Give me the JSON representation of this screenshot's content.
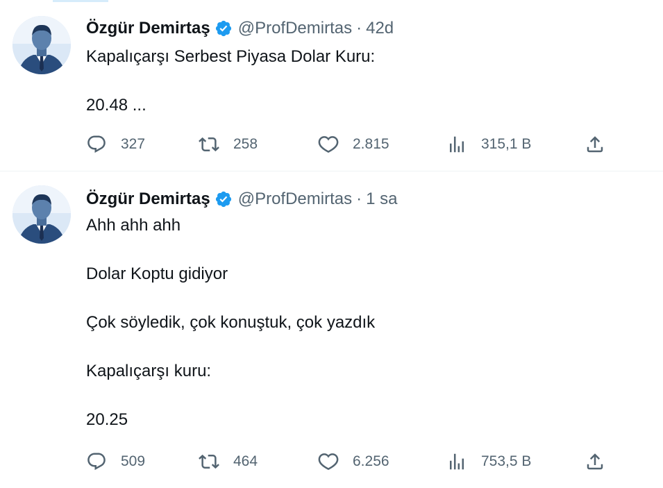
{
  "tweets": [
    {
      "author": "Özgür Demirtaş",
      "handle": "@ProfDemirtas",
      "separator": "·",
      "time": "42d",
      "paragraphs": [
        "Kapalıçarşı Serbest Piyasa Dolar Kuru:",
        "20.48 ..."
      ],
      "stats": {
        "replies": "327",
        "retweets": "258",
        "likes": "2.815",
        "views": "315,1 B"
      }
    },
    {
      "author": "Özgür Demirtaş",
      "handle": "@ProfDemirtas",
      "separator": "·",
      "time": "1 sa",
      "paragraphs": [
        "Ahh ahh ahh",
        "Dolar Koptu gidiyor",
        "Çok söyledik, çok konuştuk, çok yazdık",
        "Kapalıçarşı kuru:",
        "20.25"
      ],
      "stats": {
        "replies": "509",
        "retweets": "464",
        "likes": "6.256",
        "views": "753,5 B"
      }
    }
  ],
  "icons": {
    "verified": "verified-badge-icon",
    "reply": "reply-icon",
    "retweet": "retweet-icon",
    "like": "heart-icon",
    "views": "views-chart-icon",
    "share": "share-icon"
  },
  "colors": {
    "verified": "#1d9bf0",
    "text": "#0f1419",
    "secondary": "#536471",
    "divider": "#eff3f4"
  }
}
